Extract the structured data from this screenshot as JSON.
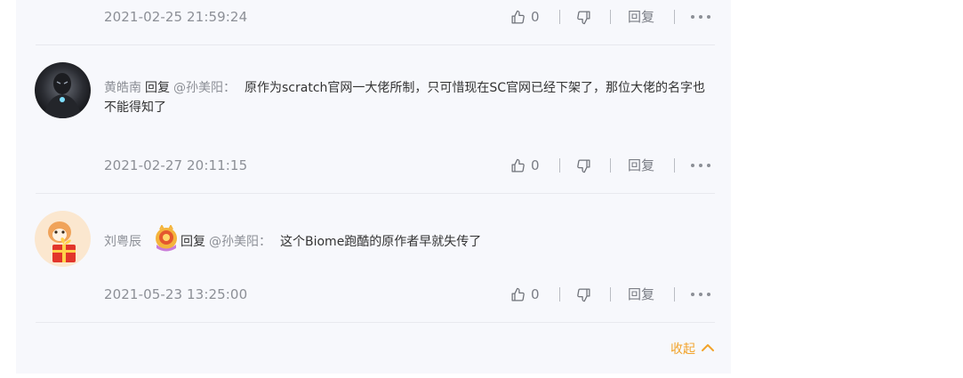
{
  "comments": [
    {
      "time": "2021-02-25 21:59:24",
      "likes": "0",
      "reply_label": "回复"
    },
    {
      "user": "黄皓南",
      "reply_word": "回复",
      "at_user": "@孙美阳：",
      "content": "原作为scratch官网一大佬所制，只可惜现在SC官网已经下架了，那位大佬的名字也不能得知了",
      "time": "2021-02-27 20:11:15",
      "likes": "0",
      "reply_label": "回复"
    },
    {
      "user": "刘粤辰",
      "reply_word": "回复",
      "at_user": "@孙美阳：",
      "content": "这个Biome跑酷的原作者早就失传了",
      "time": "2021-05-23 13:25:00",
      "likes": "0",
      "reply_label": "回复"
    }
  ],
  "collapse_label": "收起",
  "colors": {
    "panel_bg": "#f7f8fc",
    "meta_gray": "#8c8f96",
    "accent_orange": "#f2a32b"
  }
}
